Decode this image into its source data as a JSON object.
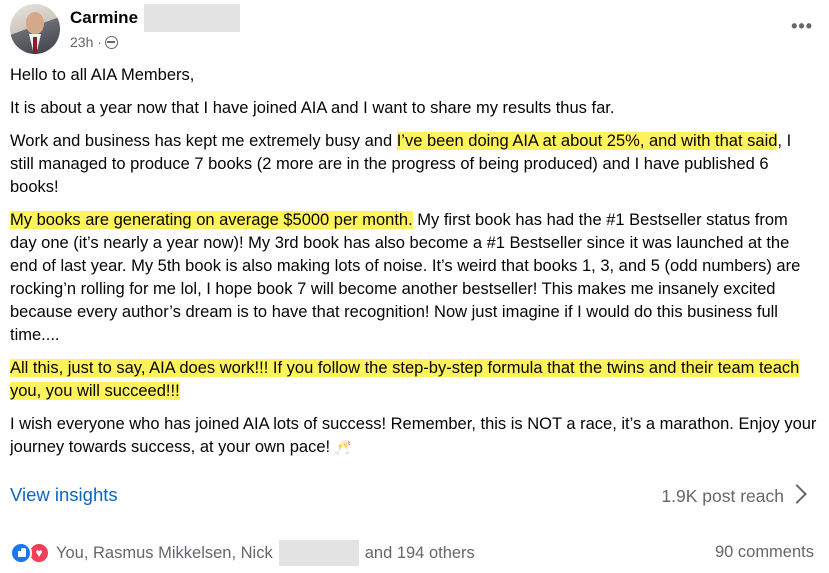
{
  "post": {
    "author_first_name": "Carmine",
    "timestamp": "23h ·",
    "audience_icon": "globe-icon",
    "more_label": "•••",
    "greeting": "Hello to all AIA Members,",
    "p1": "It is about a year now that I have joined AIA and I want to share my results thus far.",
    "p2_a": "Work and business has kept me extremely busy and ",
    "p2_hl": "I’ve been doing AIA at about 25%, and with that said",
    "p2_b": ", I still managed to produce 7 books (2 more are in the progress of being produced) and I have published 6 books!",
    "p3_hl": "My books are generating on average $5000 per month.",
    "p3_b": " My first book has had the #1 Bestseller status from day one (it’s nearly a year now)! My 3rd book has also become a #1 Bestseller since it was launched at the end of last year. My 5th book is also making lots of noise. It’s weird that books 1, 3, and 5 (odd numbers) are rocking’n rolling for me lol, I hope book 7 will become another bestseller! This makes me insanely excited because every author’s dream is to have that recognition! Now just imagine if I would do this business full time....",
    "p4_hl": "All this, just to say, AIA does work!!! If you follow the step-by-step formula that the twins and their team teach you, you will succeed!!!",
    "p5": "I wish everyone who has joined AIA lots of success! Remember, this is NOT a race, it’s a marathon. Enjoy your journey towards success, at your own pace!",
    "p5_emoji": "🥂"
  },
  "insights": {
    "view_label": "View insights",
    "reach_label": "1.9K post reach"
  },
  "reactions": {
    "names_prefix": "You, Rasmus Mikkelsen, Nick",
    "names_suffix": "and 194 others",
    "comments_label": "90 comments",
    "icons": [
      "reaction-like-icon",
      "reaction-love-icon"
    ]
  },
  "colors": {
    "link": "#0a66c2",
    "highlight": "#fff35c",
    "muted": "#65676b",
    "like": "#1877f2",
    "love": "#f33e58"
  }
}
